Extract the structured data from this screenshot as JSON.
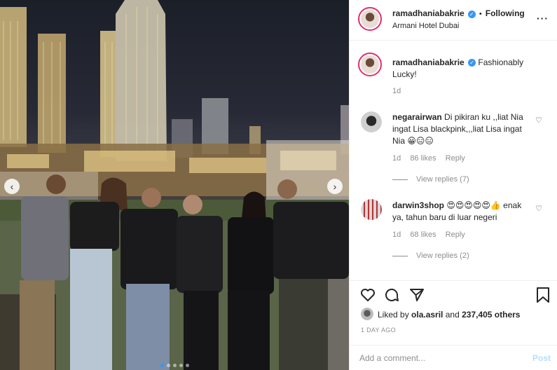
{
  "post": {
    "username": "ramadhaniabakrie",
    "follow_label": "Following",
    "separator": "•",
    "location": "Armani Hotel Dubai",
    "more_label": "···",
    "caption": "Fashionably Lucky!",
    "caption_age": "1d"
  },
  "comments": [
    {
      "username": "negarairwan",
      "text": "Di pikiran ku ,,liat Nia ingat Lisa blackpink,,,liat Lisa ingat Nia 😀😑😑",
      "age": "1d",
      "likes": "86 likes",
      "reply_label": "Reply",
      "view_replies": "View replies (7)"
    },
    {
      "username": "darwin3shop",
      "text": "😍😍😍😍😍👍 enak ya, tahun baru di luar negeri",
      "age": "1d",
      "likes": "68 likes",
      "reply_label": "Reply",
      "view_replies": "View replies (2)"
    }
  ],
  "likes": {
    "prefix": "Liked by ",
    "user": "ola.asril",
    "middle": " and ",
    "count": "237,405 others"
  },
  "timestamp": "1 DAY AGO",
  "add_comment": {
    "placeholder": "Add a comment...",
    "post_label": "Post"
  },
  "carousel": {
    "prev": "‹",
    "next": "›",
    "current_index": 1,
    "total": 5
  },
  "icons": {
    "like": "heart-icon",
    "comment": "comment-icon",
    "share": "share-icon",
    "save": "bookmark-icon",
    "verified": "verified-badge-icon"
  },
  "colors": {
    "accent": "#3897f0",
    "post_disabled": "#b2dffc",
    "muted": "#8e8e8e"
  }
}
